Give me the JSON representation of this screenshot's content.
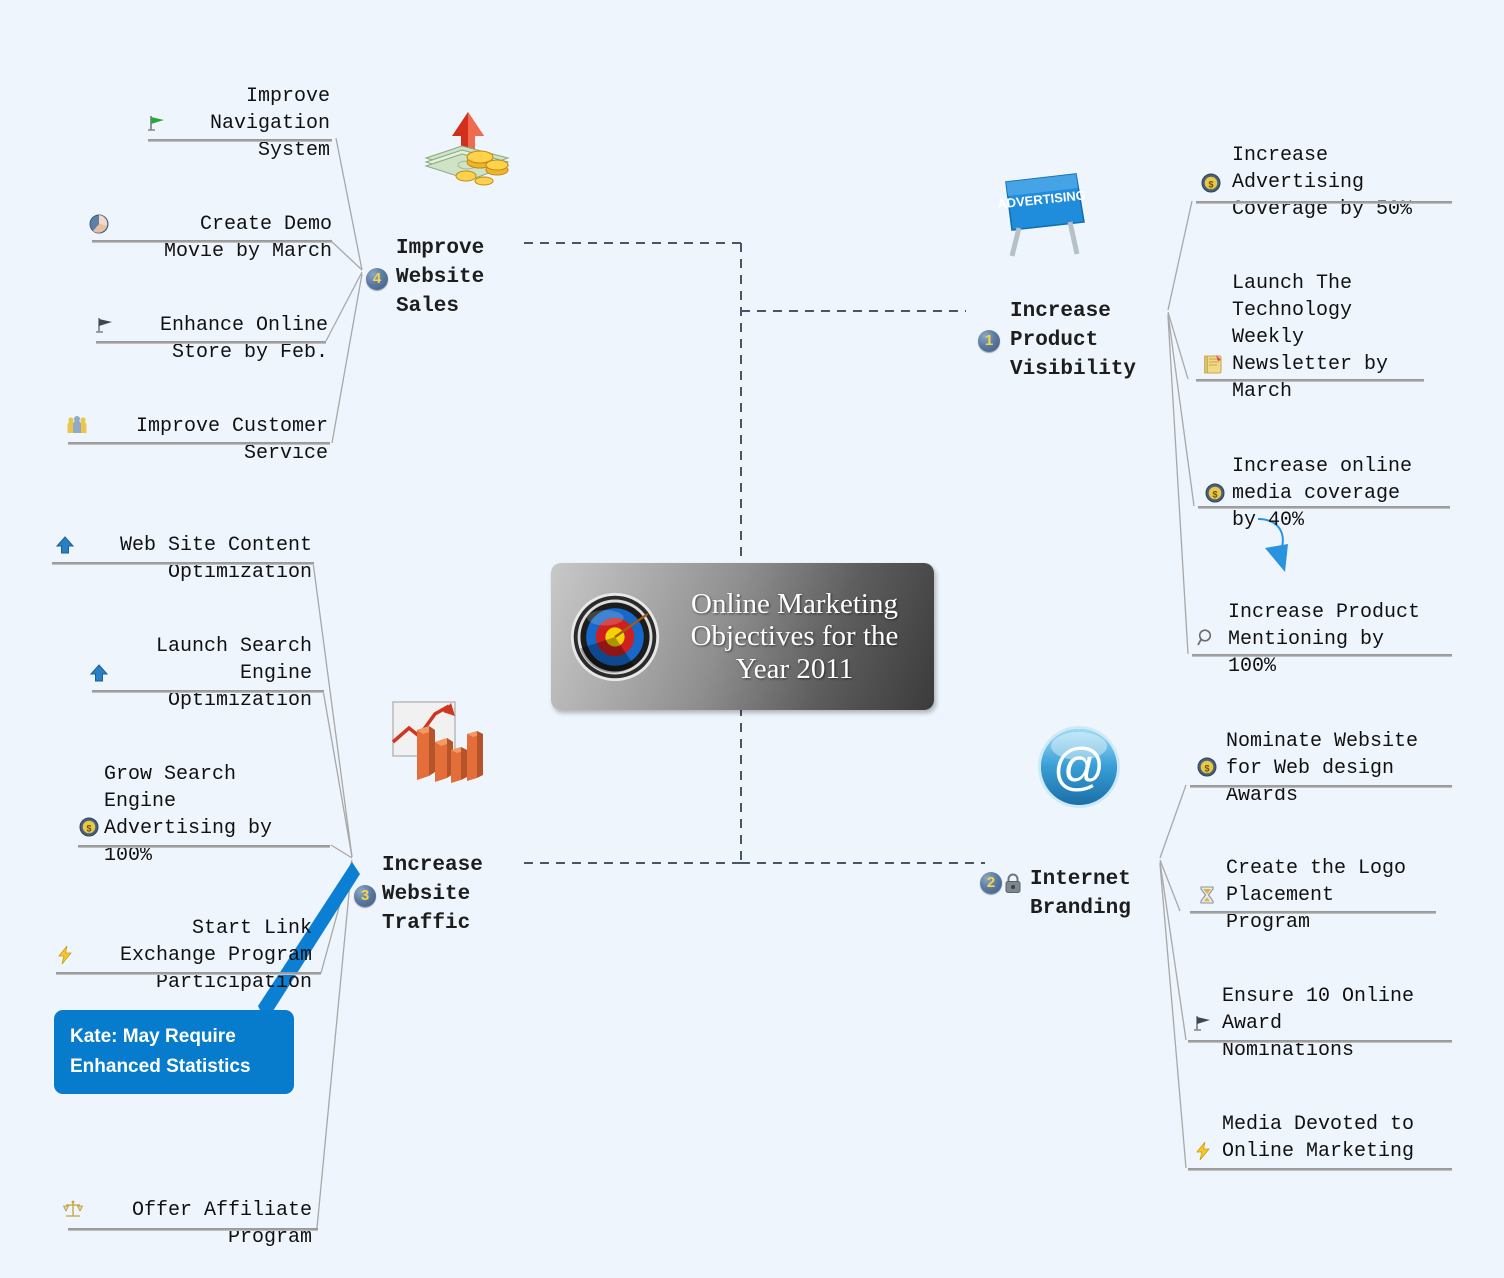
{
  "canvas": {
    "background": "#eef5fd",
    "connector_color": "#9b9b9b",
    "trunk_color": "#4a5568",
    "accent_blue": "#1e8bd8",
    "callout_blue": "#077ccd"
  },
  "root": {
    "title": "Online Marketing Objectives for the Year 2011",
    "icon": "target-icon"
  },
  "branches": [
    {
      "id": "improve-website-sales",
      "label": "Improve\nWebsite\nSales",
      "priority": "4",
      "icon": "money-growth-icon",
      "children": [
        {
          "label": "Improve\nNavigation\nSystem",
          "icon": "green-flag-icon"
        },
        {
          "label": "Create Demo\nMovie by March",
          "icon": "movie-icon"
        },
        {
          "label": "Enhance Online\nStore by Feb.",
          "icon": "dark-flag-icon"
        },
        {
          "label": "Improve Customer\nService",
          "icon": "people-icon"
        }
      ]
    },
    {
      "id": "increase-website-traffic",
      "label": "Increase\nWebsite\nTraffic",
      "priority": "3",
      "icon": "bar-chart-growth-icon",
      "children": [
        {
          "label": "Web Site Content\nOptimization",
          "icon": "blue-up-arrow-icon"
        },
        {
          "label": "Launch Search\nEngine\nOptimization",
          "icon": "blue-up-arrow-icon"
        },
        {
          "label": "Grow Search\nEngine\nAdvertising by\n100%",
          "icon": "dollar-coin-icon"
        },
        {
          "label": "Start Link\nExchange Program\nParticipation",
          "icon": "lightning-bolt-icon"
        },
        {
          "label": "Offer Affiliate\nProgram",
          "icon": "scales-icon"
        }
      ]
    },
    {
      "id": "increase-product-visibility",
      "label": "Increase\nProduct\nVisibility",
      "priority": "1",
      "icon": "advertising-billboard-icon",
      "children": [
        {
          "label": "Increase\nAdvertising\nCoverage by 50%",
          "icon": "dollar-coin-icon"
        },
        {
          "label": "Launch The\nTechnology\nWeekly\nNewsletter by\nMarch",
          "icon": "notepad-icon"
        },
        {
          "label": "Increase online\nmedia coverage\nby 40%",
          "icon": "dollar-coin-icon"
        },
        {
          "label": "Increase Product\nMentioning by\n100%",
          "icon": "magnifier-icon"
        }
      ]
    },
    {
      "id": "internet-branding",
      "label": "Internet\nBranding",
      "priority": "2",
      "icon": "at-sign-icon",
      "lock": "lock-icon",
      "children": [
        {
          "label": "Nominate Website\nfor Web design\nAwards",
          "icon": "dollar-coin-icon"
        },
        {
          "label": "Create the Logo\nPlacement\nProgram",
          "icon": "hourglass-icon"
        },
        {
          "label": "Ensure 10 Online\nAward\nNominations",
          "icon": "dark-flag-icon"
        },
        {
          "label": "Media Devoted to\nOnline Marketing",
          "icon": "lightning-bolt-icon"
        }
      ]
    }
  ],
  "callout": {
    "text": "Kate: May Require Enhanced Statistics",
    "attached_to": "increase-website-traffic"
  }
}
